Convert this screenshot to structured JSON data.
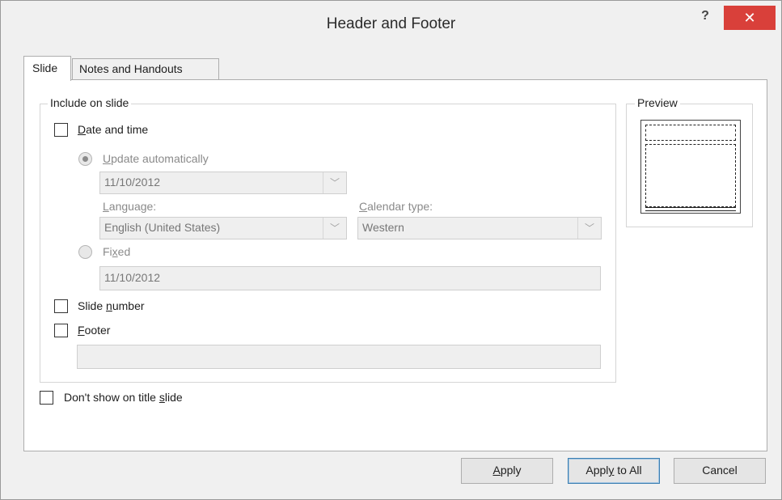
{
  "window": {
    "title": "Header and Footer",
    "help_label": "?",
    "close_label": "✕"
  },
  "tabs": [
    {
      "label": "Slide",
      "active": true
    },
    {
      "label": "Notes and Handouts",
      "active": false
    }
  ],
  "include_group": {
    "legend": "Include on slide",
    "date_time": {
      "label": "Date and time",
      "underline": "D",
      "checked": false
    },
    "update_auto": {
      "label": "Update automatically",
      "underline": "U",
      "selected": true
    },
    "date_value": "11/10/2012",
    "language_label": "Language:",
    "language_value": "English (United States)",
    "calendar_label": "Calendar type:",
    "calendar_value": "Western",
    "fixed": {
      "label": "Fixed",
      "selected": false
    },
    "fixed_value": "11/10/2012",
    "slide_number": {
      "label": "Slide number",
      "checked": false
    },
    "footer": {
      "label": "Footer",
      "checked": false
    },
    "footer_value": ""
  },
  "dont_show_title": {
    "label": "Don't show on title slide",
    "checked": false
  },
  "preview": {
    "legend": "Preview"
  },
  "buttons": {
    "apply": "Apply",
    "apply_all": "Apply to All",
    "cancel": "Cancel"
  },
  "colors": {
    "close_button": "#d9403a",
    "default_button_border": "#3c7fb1"
  },
  "icons": {
    "dropdown": "chevron-down-icon",
    "close": "close-icon",
    "help": "help-icon"
  }
}
